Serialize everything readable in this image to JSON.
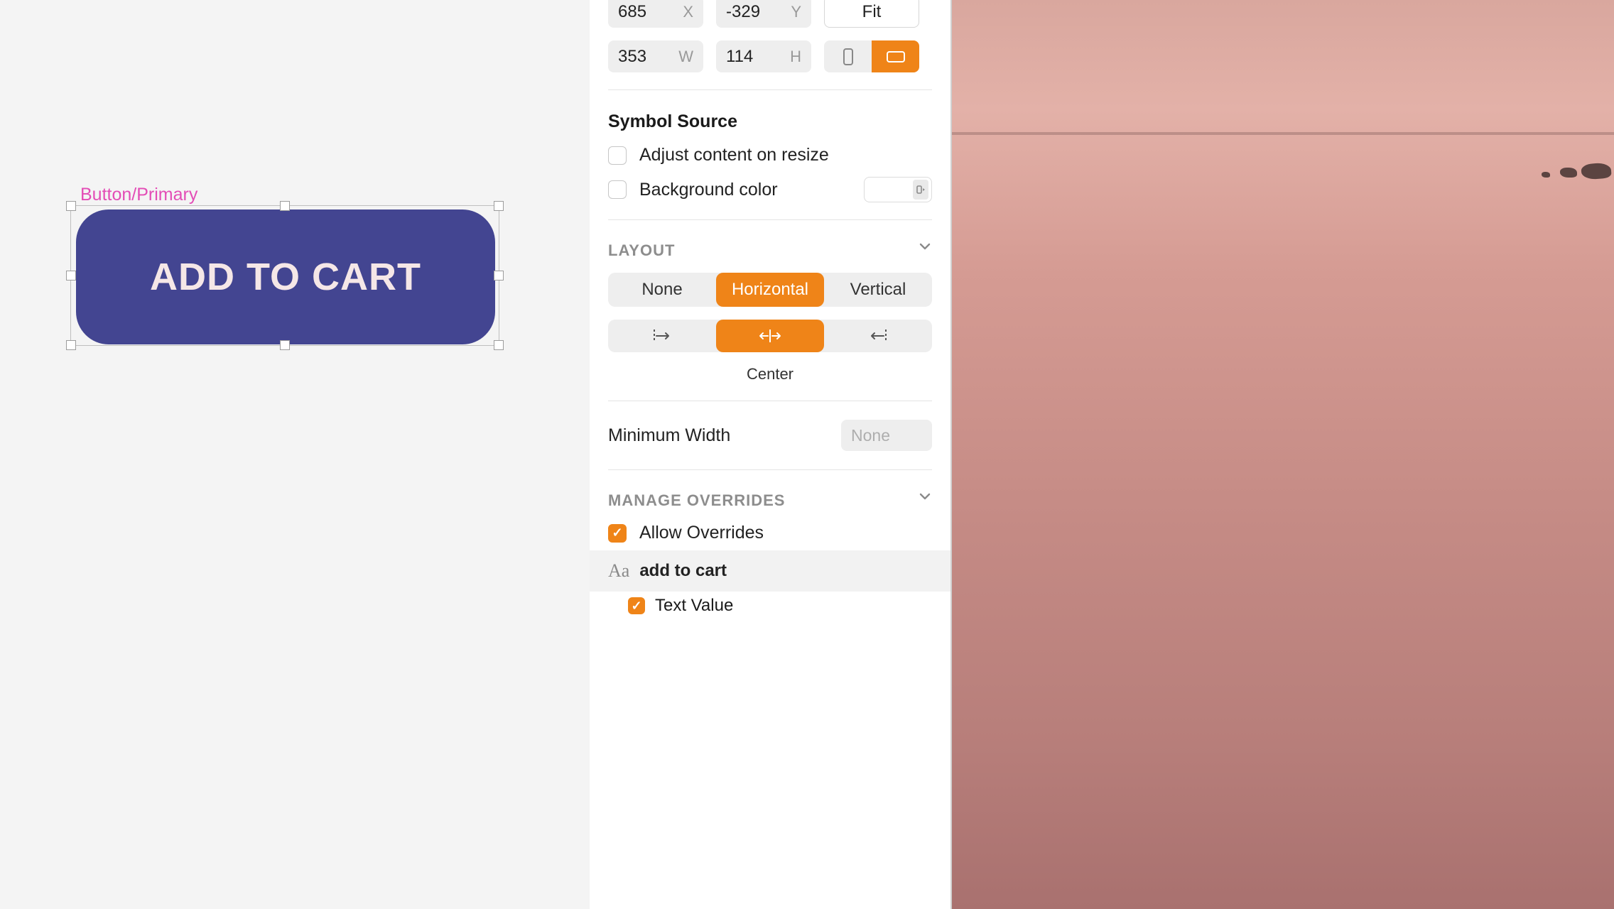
{
  "canvas": {
    "artboard_label": "Button/Primary",
    "button_text": "ADD TO CART"
  },
  "inspector": {
    "position": {
      "x": "685",
      "y": "-329",
      "x_label": "X",
      "y_label": "Y"
    },
    "size": {
      "w": "353",
      "h": "114",
      "w_label": "W",
      "h_label": "H"
    },
    "fit_label": "Fit",
    "symbol_source": {
      "title": "Symbol Source",
      "adjust_content": "Adjust content on resize",
      "background_color": "Background color"
    },
    "layout": {
      "title": "LAYOUT",
      "options": {
        "none": "None",
        "horizontal": "Horizontal",
        "vertical": "Vertical"
      },
      "align_label": "Center"
    },
    "min_width": {
      "label": "Minimum Width",
      "placeholder": "None"
    },
    "overrides": {
      "title": "MANAGE OVERRIDES",
      "allow_label": "Allow Overrides",
      "item_label": "add to cart",
      "child_label": "Text Value"
    }
  }
}
